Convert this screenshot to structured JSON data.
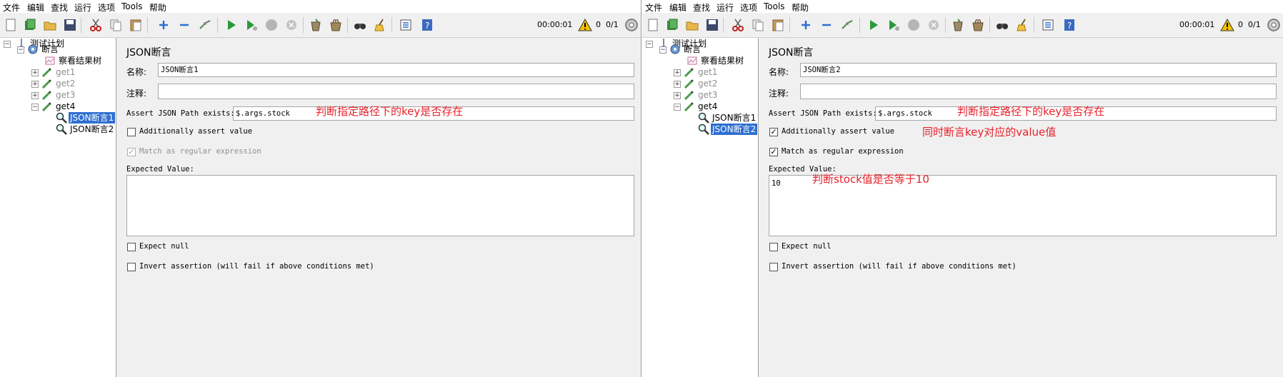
{
  "menu": [
    "文件",
    "编辑",
    "查找",
    "运行",
    "选项",
    "Tools",
    "帮助"
  ],
  "toolbar": {
    "timer": "00:00:01",
    "warnings": "0",
    "threads": "0/1"
  },
  "colors": {
    "annotation": "#e8212a",
    "selection": "#2f6fd0",
    "disabled_text": "#909090"
  },
  "panes": [
    {
      "tree": [
        {
          "label": "测试计划",
          "icon": "test-plan-icon"
        },
        {
          "label": "断言",
          "icon": "thread-group-gear-icon"
        },
        {
          "label": "察看结果树",
          "icon": "results-tree-icon"
        },
        {
          "label": "get1",
          "icon": "sampler-pipette-icon"
        },
        {
          "label": "get2",
          "icon": "sampler-pipette-icon"
        },
        {
          "label": "get3",
          "icon": "sampler-pipette-icon"
        },
        {
          "label": "get4",
          "icon": "sampler-pipette-icon"
        },
        {
          "label": "JSON断言1",
          "icon": "assertion-magnifier-icon"
        },
        {
          "label": "JSON断言2",
          "icon": "assertion-magnifier-icon"
        }
      ],
      "selected_index": 7,
      "form": {
        "title": "JSON断言",
        "name_label": "名称:",
        "name_value": "JSON断言1",
        "comment_label": "注释:",
        "comment_value": "",
        "path_label": "Assert JSON Path exists:",
        "path_value": "$.args.stock",
        "additionally_label": "Additionally assert value",
        "additionally_checked": false,
        "regex_label": "Match as regular expression",
        "regex_checked": true,
        "regex_disabled": true,
        "expected_label": "Expected Value:",
        "expected_value": "",
        "null_label": "Expect null",
        "null_checked": false,
        "invert_label": "Invert assertion (will fail if above conditions met)",
        "invert_checked": false
      },
      "notes": {
        "path_note": "判断指定路径下的key是否存在",
        "value_note": "",
        "expected_note": ""
      }
    },
    {
      "tree": [
        {
          "label": "测试计划",
          "icon": "test-plan-icon"
        },
        {
          "label": "断言",
          "icon": "thread-group-gear-icon"
        },
        {
          "label": "察看结果树",
          "icon": "results-tree-icon"
        },
        {
          "label": "get1",
          "icon": "sampler-pipette-icon"
        },
        {
          "label": "get2",
          "icon": "sampler-pipette-icon"
        },
        {
          "label": "get3",
          "icon": "sampler-pipette-icon"
        },
        {
          "label": "get4",
          "icon": "sampler-pipette-icon"
        },
        {
          "label": "JSON断言1",
          "icon": "assertion-magnifier-icon"
        },
        {
          "label": "JSON断言2",
          "icon": "assertion-magnifier-icon"
        }
      ],
      "selected_index": 8,
      "form": {
        "title": "JSON断言",
        "name_label": "名称:",
        "name_value": "JSON断言2",
        "comment_label": "注释:",
        "comment_value": "",
        "path_label": "Assert JSON Path exists:",
        "path_value": "$.args.stock",
        "additionally_label": "Additionally assert value",
        "additionally_checked": true,
        "regex_label": "Match as regular expression",
        "regex_checked": true,
        "regex_disabled": false,
        "expected_label": "Expected Value:",
        "expected_value": "10",
        "null_label": "Expect null",
        "null_checked": false,
        "invert_label": "Invert assertion (will fail if above conditions met)",
        "invert_checked": false
      },
      "notes": {
        "path_note": "判断指定路径下的key是否存在",
        "value_note": "同时断言key对应的value值",
        "expected_note": "判断stock值是否等于10"
      }
    }
  ]
}
